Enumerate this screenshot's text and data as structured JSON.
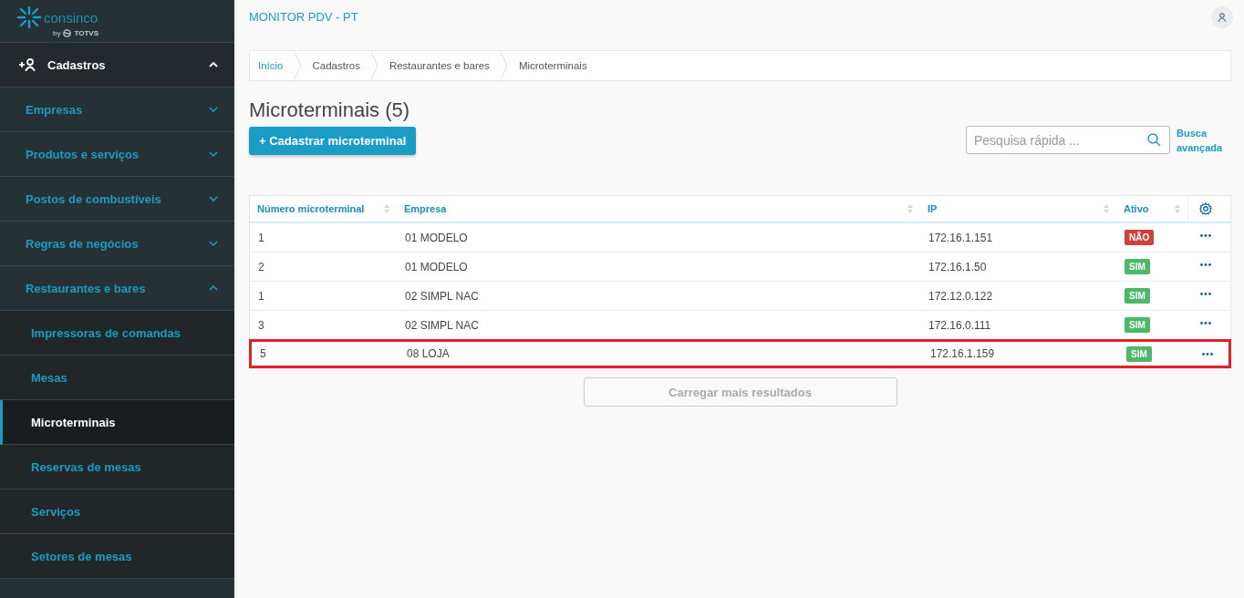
{
  "logo": {
    "name": "consinco",
    "byline_by": "by",
    "byline_brand": "TOTVS"
  },
  "sidebar": {
    "section": {
      "label": "Cadastros",
      "expanded": true
    },
    "items": [
      {
        "label": "Empresas",
        "expanded": false
      },
      {
        "label": "Produtos e serviços",
        "expanded": false
      },
      {
        "label": "Postos de combustíveis",
        "expanded": false
      },
      {
        "label": "Regras de negócios",
        "expanded": false
      },
      {
        "label": "Restaurantes e bares",
        "expanded": true,
        "children": [
          {
            "label": "Impressoras de comandas",
            "selected": false
          },
          {
            "label": "Mesas",
            "selected": false
          },
          {
            "label": "Microterminais",
            "selected": true
          },
          {
            "label": "Reservas de mesas",
            "selected": false
          },
          {
            "label": "Serviços",
            "selected": false
          },
          {
            "label": "Setores de mesas",
            "selected": false
          }
        ]
      }
    ]
  },
  "header": {
    "title": "MONITOR PDV - PT"
  },
  "breadcrumb": [
    "Início",
    "Cadastros",
    "Restaurantes e bares",
    "Microterminais"
  ],
  "page": {
    "title": "Microterminais (5)",
    "add_button": "+ Cadastrar microterminal",
    "search": {
      "placeholder": "Pesquisa rápida ..."
    },
    "advanced_search": "Busca avançada"
  },
  "table": {
    "columns": [
      "Número microterminal",
      "Empresa",
      "IP",
      "Ativo"
    ],
    "rows": [
      {
        "cells": [
          "1",
          "01 MODELO",
          "172.16.1.151"
        ],
        "active": "NÃO",
        "active_state": false,
        "highlighted": false
      },
      {
        "cells": [
          "2",
          "01 MODELO",
          "172.16.1.50"
        ],
        "active": "SIM",
        "active_state": true,
        "highlighted": false
      },
      {
        "cells": [
          "1",
          "02 SIMPL NAC",
          "172.12.0.122"
        ],
        "active": "SIM",
        "active_state": true,
        "highlighted": false
      },
      {
        "cells": [
          "3",
          "02 SIMPL NAC",
          "172.16.0.111"
        ],
        "active": "SIM",
        "active_state": true,
        "highlighted": false
      },
      {
        "cells": [
          "5",
          "08 LOJA",
          "172.16.1.159"
        ],
        "active": "SIM",
        "active_state": true,
        "highlighted": true
      }
    ],
    "load_more": {
      "label": "Carregar mais resultados",
      "disabled": true
    }
  }
}
